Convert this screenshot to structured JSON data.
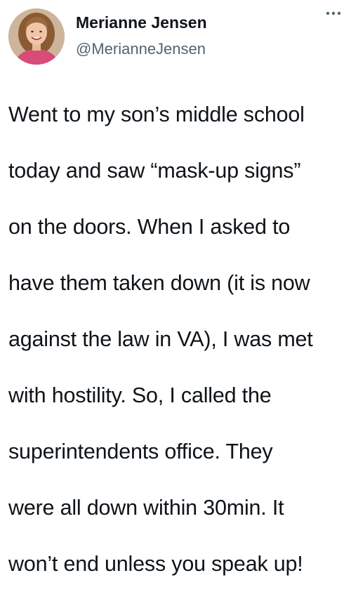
{
  "tweet": {
    "author": {
      "display_name": "Merianne Jensen",
      "handle": "@MerianneJensen",
      "avatar_icon": "profile-photo"
    },
    "more_icon": "more-options-icon",
    "text_lines": [
      "Went to my son’s middle school",
      "today and saw “mask-up signs”",
      "on the doors. When I asked to",
      "have them taken down (it is now",
      "against the law in VA), I was met",
      "with hostility. So, I called the",
      "superintendents office. They",
      "were all down within 30min. It",
      "won’t end unless you speak up!"
    ]
  },
  "colors": {
    "text_primary": "#0f1419",
    "text_secondary": "#536471",
    "background": "#ffffff"
  }
}
